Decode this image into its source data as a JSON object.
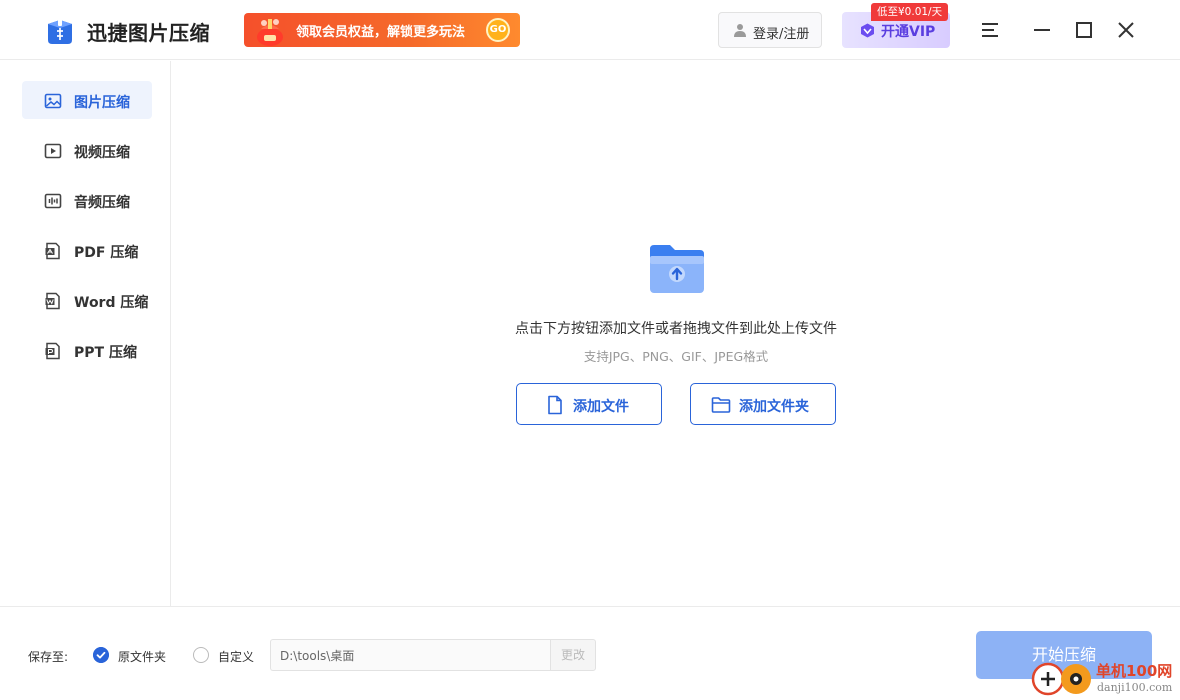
{
  "header": {
    "app_title": "迅捷图片压缩",
    "promo_text": "领取会员权益，解锁更多玩法",
    "promo_go": "GO",
    "login_label": "登录/注册",
    "vip_label": "开通VIP",
    "vip_badge": "低至¥0.01/天",
    "window_controls": [
      "menu-icon",
      "minimize-icon",
      "maximize-icon",
      "close-icon"
    ]
  },
  "sidebar": {
    "items": [
      {
        "label": "图片压缩",
        "icon": "image-icon",
        "active": true
      },
      {
        "label": "视频压缩",
        "icon": "video-icon",
        "active": false
      },
      {
        "label": "音频压缩",
        "icon": "audio-icon",
        "active": false
      },
      {
        "label": "PDF 压缩",
        "icon": "pdf-icon",
        "active": false
      },
      {
        "label": "Word 压缩",
        "icon": "word-icon",
        "active": false
      },
      {
        "label": "PPT 压缩",
        "icon": "ppt-icon",
        "active": false
      }
    ]
  },
  "main": {
    "drop_hint": "点击下方按钮添加文件或者拖拽文件到此处上传文件",
    "formats": "支持JPG、PNG、GIF、JPEG格式",
    "add_file_label": "添加文件",
    "add_folder_label": "添加文件夹"
  },
  "footer": {
    "save_label": "保存至:",
    "option_original": "原文件夹",
    "option_custom": "自定义",
    "selected_option": "原文件夹",
    "path_value": "D:\\tools\\桌面",
    "change_label": "更改",
    "start_label": "开始压缩"
  },
  "watermark": {
    "site_name": "单机100网",
    "site_url": "danji100.com"
  },
  "colors": {
    "accent": "#2a64d9",
    "active_bg": "#eef3fd",
    "promo": "#f5502b",
    "vip_text": "#5a3ee0",
    "start_disabled": "#8db2f5"
  }
}
